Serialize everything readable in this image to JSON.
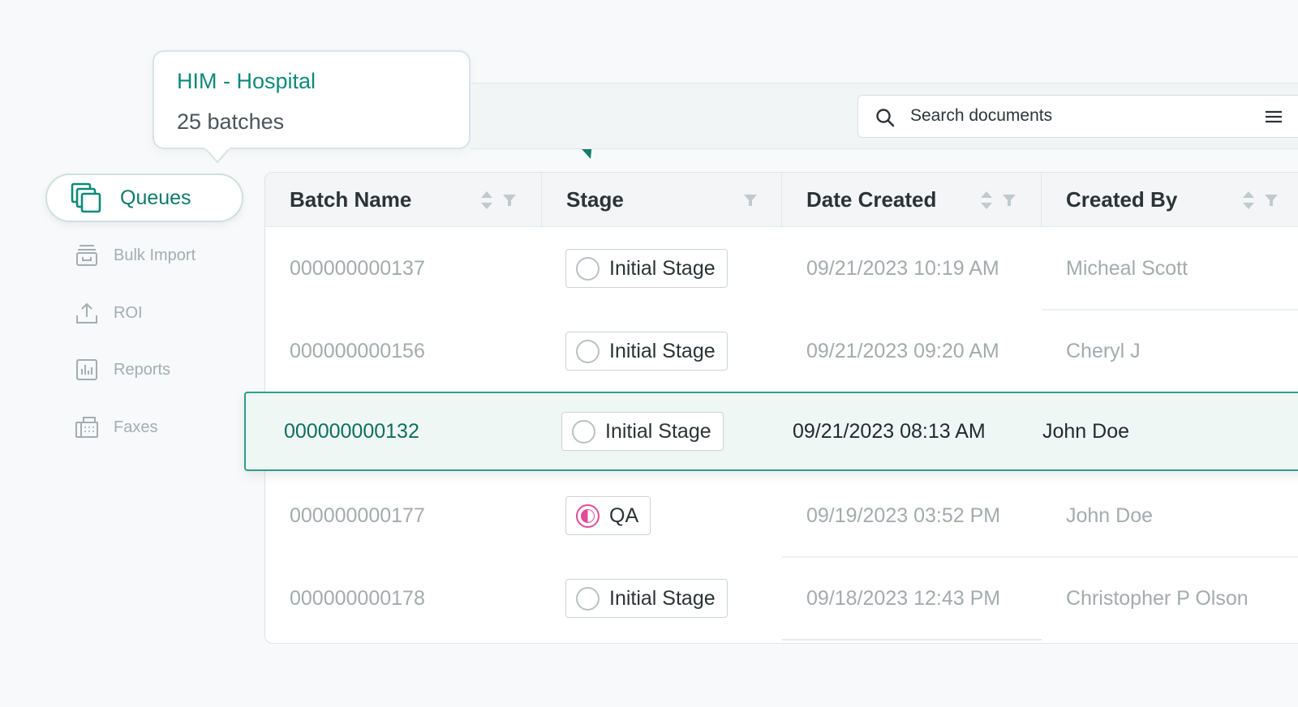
{
  "tooltip": {
    "title": "HIM - Hospital",
    "subtitle": "25 batches"
  },
  "search": {
    "placeholder": "Search documents"
  },
  "sidebar": {
    "active": {
      "label": "Queues",
      "icon": "queues-icon"
    },
    "items": [
      {
        "label": "Bulk Import",
        "icon": "bulk-import-icon"
      },
      {
        "label": "ROI",
        "icon": "upload-icon"
      },
      {
        "label": "Reports",
        "icon": "reports-icon"
      },
      {
        "label": "Faxes",
        "icon": "fax-icon"
      }
    ]
  },
  "table": {
    "columns": [
      {
        "label": "Batch Name"
      },
      {
        "label": "Stage"
      },
      {
        "label": "Date Created"
      },
      {
        "label": "Created By"
      }
    ],
    "rows": [
      {
        "batch": "000000000137",
        "stage": "Initial Stage",
        "date": "09/21/2023 10:19 AM",
        "by": "Micheal Scott"
      },
      {
        "batch": "000000000156",
        "stage": "Initial Stage",
        "date": "09/21/2023 09:20 AM",
        "by": "Cheryl J"
      },
      {
        "batch": "000000000132",
        "stage": "Initial Stage",
        "date": "09/21/2023 08:13 AM",
        "by": "John Doe"
      },
      {
        "batch": "000000000177",
        "stage": "QA",
        "date": "09/19/2023 03:52 PM",
        "by": "John Doe"
      },
      {
        "batch": "000000000178",
        "stage": "Initial Stage",
        "date": "09/18/2023 12:43 PM",
        "by": "Christopher P Olson"
      }
    ]
  },
  "colors": {
    "accent": "#0f8a79",
    "highlight_border": "#2f9d8b",
    "highlight_bg": "#eff7f5",
    "qa": "#e04c9a"
  }
}
